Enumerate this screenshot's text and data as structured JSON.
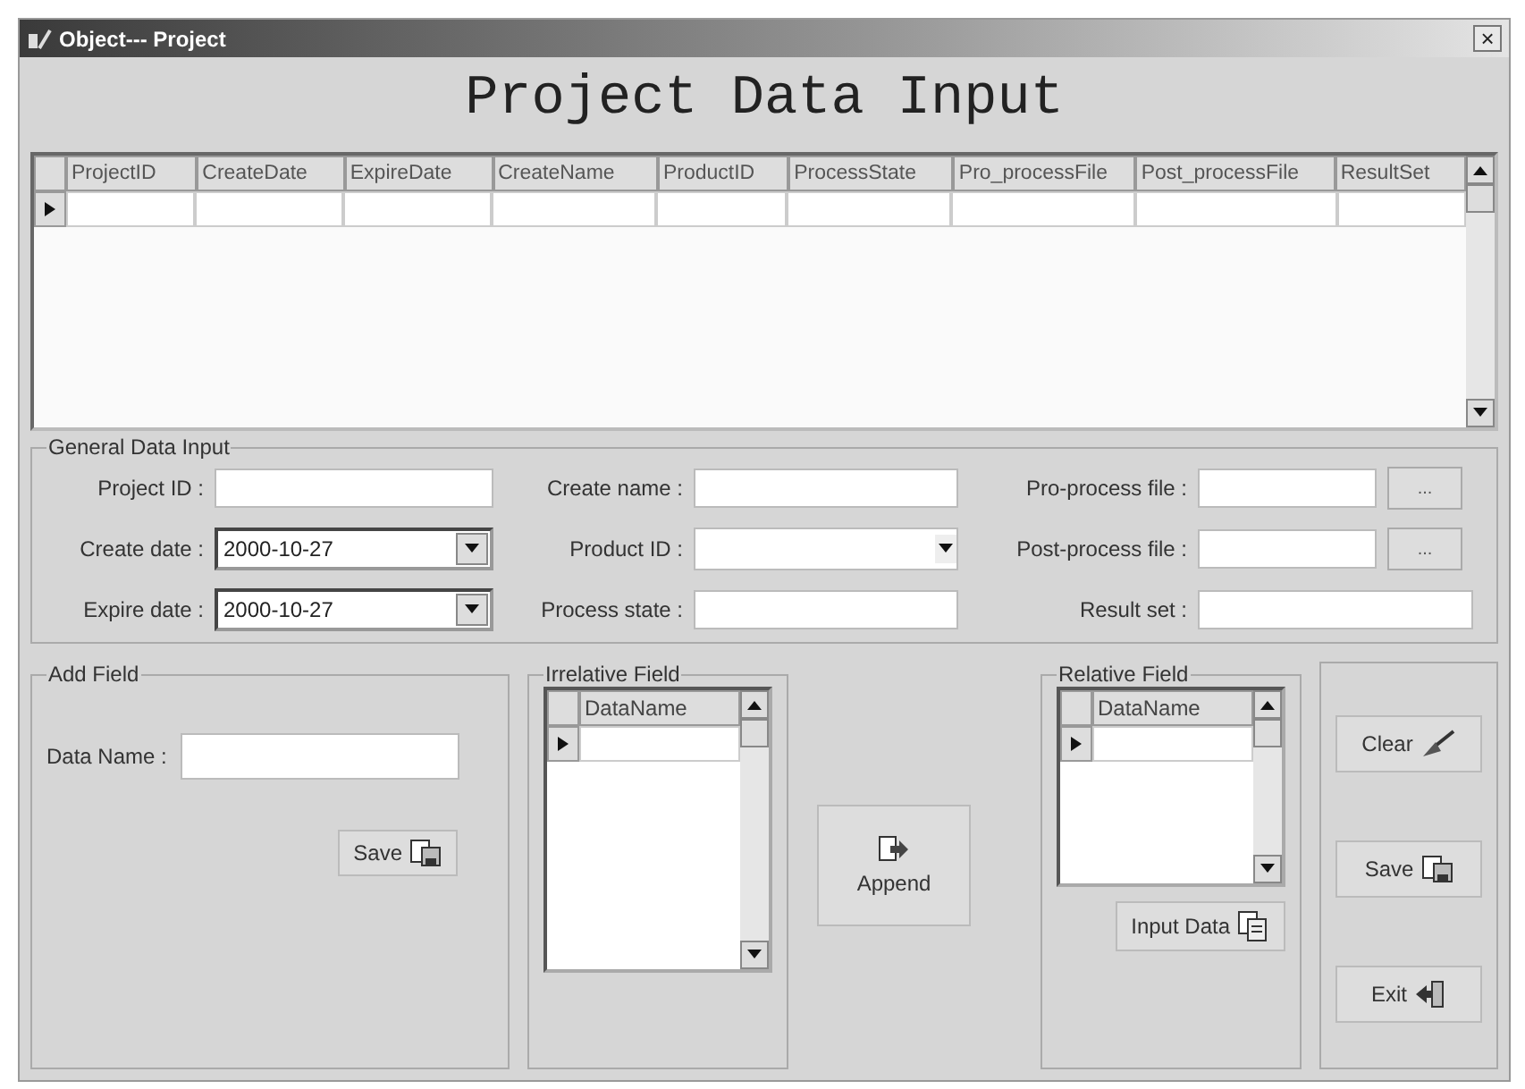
{
  "window": {
    "title": "Object--- Project",
    "close": "×"
  },
  "heading": "Project Data Input",
  "table": {
    "columns": [
      "ProjectID",
      "CreateDate",
      "ExpireDate",
      "CreateName",
      "ProductID",
      "ProcessState",
      "Pro_processFile",
      "Post_processFile",
      "ResultSet"
    ]
  },
  "general": {
    "title": "General Data Input",
    "fields": [
      {
        "label": "Project ID :",
        "kind": "text"
      },
      {
        "label": "Create name :",
        "kind": "text"
      },
      {
        "label": "Pro-process file :",
        "kind": "file",
        "button": "..."
      },
      {
        "label": "Create date :",
        "kind": "date",
        "value": "2000-10-27"
      },
      {
        "label": "Product ID :",
        "kind": "combo"
      },
      {
        "label": "Post-process file :",
        "kind": "file",
        "button": "..."
      },
      {
        "label": "Expire date :",
        "kind": "date",
        "value": "2000-10-27"
      },
      {
        "label": "Process state :",
        "kind": "text"
      },
      {
        "label": "Result set :",
        "kind": "wide"
      }
    ]
  },
  "add_field": {
    "title": "Add Field",
    "label": "Data Name :",
    "button": "Save"
  },
  "irrelative_field": {
    "title": "Irrelative Field",
    "column": "DataName"
  },
  "append_button": "Append",
  "relative_field": {
    "title": "Relative Field",
    "column": "DataName",
    "button": "Input Data"
  },
  "actions": [
    {
      "label": "Clear",
      "kind": "clear"
    },
    {
      "label": "Save",
      "kind": "save"
    },
    {
      "label": "Exit",
      "kind": "exit"
    }
  ]
}
